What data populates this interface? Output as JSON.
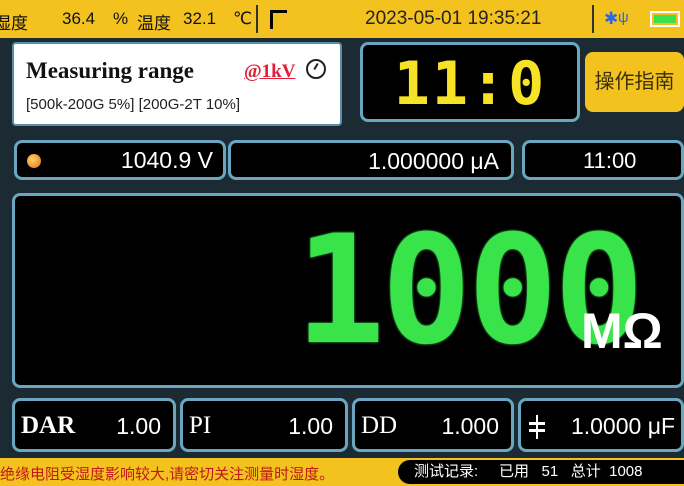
{
  "status": {
    "humidity_label": "湿度",
    "humidity_value": "36.4",
    "humidity_unit": "%",
    "temp_label": "温度",
    "temp_value": "32.1",
    "temp_unit": "℃",
    "datetime": "2023-05-01 19:35:21",
    "bluetooth_icon": "bluetooth-icon",
    "usb_icon": "usb-icon",
    "battery_icon": "battery-icon"
  },
  "measure": {
    "title": "Measuring range",
    "voltage": "@1kV",
    "ranges": "[500k-200G  5%]   [200G-2T  10%]"
  },
  "timer": {
    "digits": "11:0"
  },
  "guide_button": "操作指南",
  "readings": {
    "voltage": "1040.9 V",
    "current": "1.000000 μA",
    "time": "11:00"
  },
  "main": {
    "value": "1000",
    "unit": "MΩ"
  },
  "indices": {
    "dar_label": "DAR",
    "dar_value": "1.00",
    "pi_label": "PI",
    "pi_value": "1.00",
    "dd_label": "DD",
    "dd_value": "1.000",
    "cap_value": "1.0000 μF"
  },
  "footer": {
    "message": "绝缘电阻受湿度影响较大,请密切关注测量时湿度。",
    "records_label": "测试记录:",
    "used_label": "已用",
    "used_value": "51",
    "total_label": "总计",
    "total_value": "1008"
  },
  "colors": {
    "accent": "#f3c21f",
    "display_green": "#39e34a",
    "timer_yellow": "#f7e325",
    "frame": "#6aa6c0"
  }
}
